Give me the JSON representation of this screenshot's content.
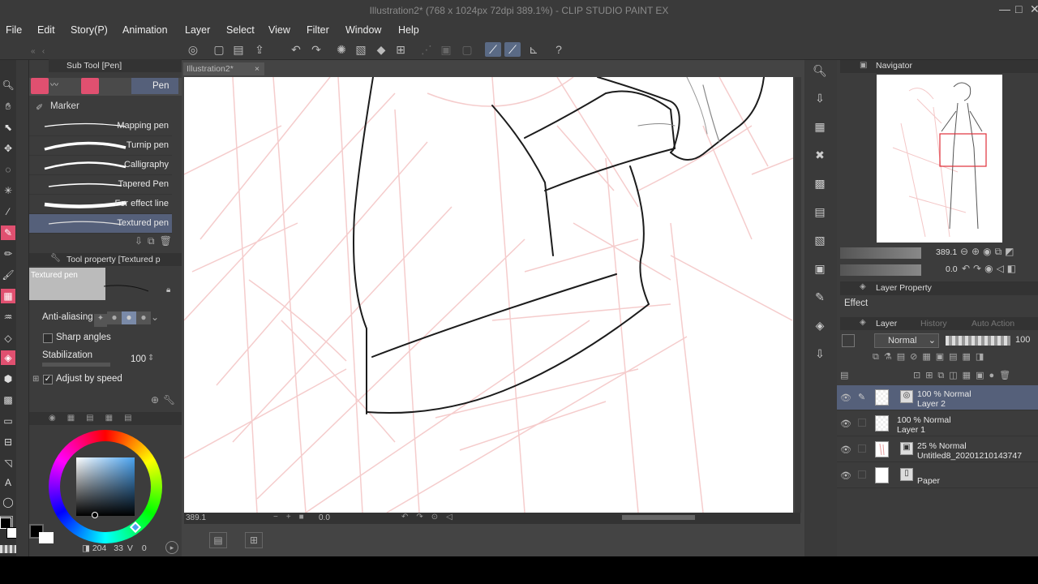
{
  "window": {
    "title": "Illustration2* (768 x 1024px 72dpi 389.1%)  - CLIP STUDIO PAINT EX",
    "controls": [
      "—",
      "□",
      "✕"
    ]
  },
  "menu": [
    "File",
    "Edit",
    "Story(P)",
    "Animation",
    "Layer",
    "Select",
    "View",
    "Filter",
    "Window",
    "Help"
  ],
  "subtool_panel": {
    "title": "Sub Tool [Pen]",
    "groups": [
      "Pen",
      "Marker"
    ],
    "brushes": [
      "Mapping pen",
      "Turnip pen",
      "Calligraphy",
      "Tapered Pen",
      "For effect line",
      "Textured pen"
    ],
    "selected_brush": "Textured pen"
  },
  "tool_property": {
    "title": "Tool property [Textured p",
    "preview_label": "Textured pen",
    "antialiasing_label": "Anti-aliasing",
    "sharp_angles_label": "Sharp angles",
    "stabilization_label": "Stabilization",
    "stabilization_value": "100",
    "adjust_speed_label": "Adjust by speed"
  },
  "color": {
    "readout_a": "204",
    "readout_b": "33",
    "readout_c": "V",
    "readout_d": "0",
    "main_color": "#000000",
    "sub_color": "#ffffff"
  },
  "canvas": {
    "tab_label": "Illustration2*",
    "zoom_status": "389.1",
    "rotation_status": "0.0"
  },
  "navigator": {
    "title": "Navigator",
    "zoom": "389.1",
    "rotation": "0.0"
  },
  "layer_property": {
    "title": "Layer Property",
    "effect_label": "Effect"
  },
  "layer_panel": {
    "tabs": [
      "Layer",
      "History",
      "Auto Action"
    ],
    "blend_mode": "Normal",
    "opacity": "100",
    "layers": [
      {
        "line1": "100 % Normal",
        "line2": "Layer 2",
        "selected": true
      },
      {
        "line1": "100 % Normal",
        "line2": "Layer 1",
        "selected": false
      },
      {
        "line1": "25 % Normal",
        "line2": "Untitled8_20201210143747",
        "selected": false
      },
      {
        "line1": "",
        "line2": "Paper",
        "selected": false
      }
    ]
  }
}
